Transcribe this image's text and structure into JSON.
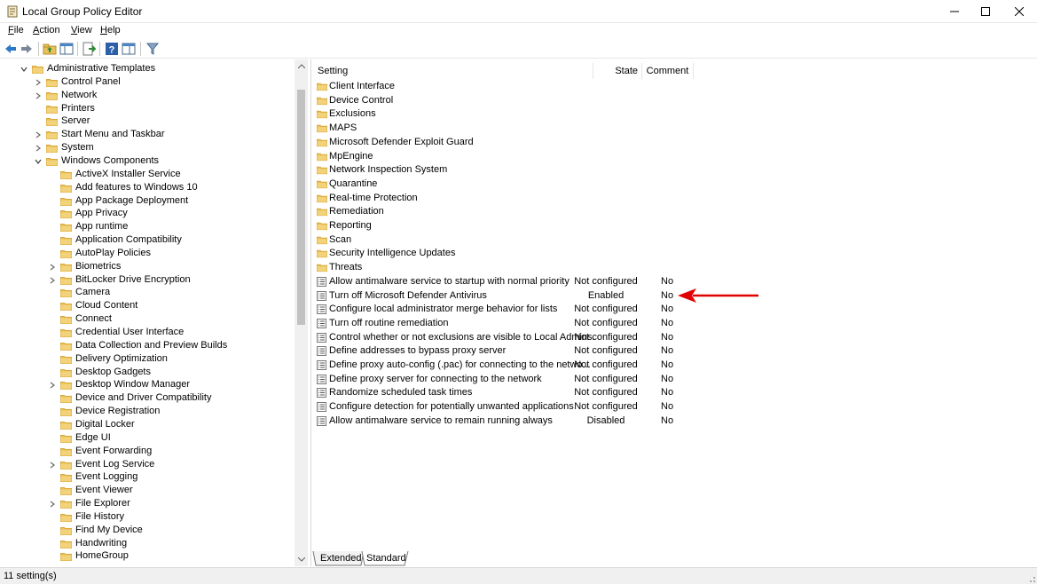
{
  "window": {
    "title": "Local Group Policy Editor",
    "app_icon": "policy-editor-icon",
    "controls": [
      "minimize-icon",
      "maximize-icon",
      "close-icon"
    ]
  },
  "menu": {
    "file": {
      "key": "F",
      "rest": "ile"
    },
    "action": {
      "key": "A",
      "rest": "ction"
    },
    "view": {
      "key": "V",
      "rest": "iew"
    },
    "help": {
      "key": "H",
      "rest": "elp"
    }
  },
  "toolbar": {
    "icons": [
      "back-icon",
      "forward-icon",
      "up-folder-icon",
      "show-hide-tree-icon",
      "export-list-icon",
      "help-icon",
      "extended-view-icon",
      "filter-icon"
    ]
  },
  "tree": {
    "items": [
      {
        "label": "Administrative Templates",
        "level": 1,
        "expander": "expanded"
      },
      {
        "label": "Control Panel",
        "level": 2,
        "expander": "collapsed"
      },
      {
        "label": "Network",
        "level": 2,
        "expander": "collapsed"
      },
      {
        "label": "Printers",
        "level": 2,
        "expander": "none"
      },
      {
        "label": "Server",
        "level": 2,
        "expander": "none"
      },
      {
        "label": "Start Menu and Taskbar",
        "level": 2,
        "expander": "collapsed"
      },
      {
        "label": "System",
        "level": 2,
        "expander": "collapsed"
      },
      {
        "label": "Windows Components",
        "level": 2,
        "expander": "expanded"
      },
      {
        "label": "ActiveX Installer Service",
        "level": 3,
        "expander": "none"
      },
      {
        "label": "Add features to Windows 10",
        "level": 3,
        "expander": "none"
      },
      {
        "label": "App Package Deployment",
        "level": 3,
        "expander": "none"
      },
      {
        "label": "App Privacy",
        "level": 3,
        "expander": "none"
      },
      {
        "label": "App runtime",
        "level": 3,
        "expander": "none"
      },
      {
        "label": "Application Compatibility",
        "level": 3,
        "expander": "none"
      },
      {
        "label": "AutoPlay Policies",
        "level": 3,
        "expander": "none"
      },
      {
        "label": "Biometrics",
        "level": 3,
        "expander": "collapsed"
      },
      {
        "label": "BitLocker Drive Encryption",
        "level": 3,
        "expander": "collapsed"
      },
      {
        "label": "Camera",
        "level": 3,
        "expander": "none"
      },
      {
        "label": "Cloud Content",
        "level": 3,
        "expander": "none"
      },
      {
        "label": "Connect",
        "level": 3,
        "expander": "none"
      },
      {
        "label": "Credential User Interface",
        "level": 3,
        "expander": "none"
      },
      {
        "label": "Data Collection and Preview Builds",
        "level": 3,
        "expander": "none"
      },
      {
        "label": "Delivery Optimization",
        "level": 3,
        "expander": "none"
      },
      {
        "label": "Desktop Gadgets",
        "level": 3,
        "expander": "none"
      },
      {
        "label": "Desktop Window Manager",
        "level": 3,
        "expander": "collapsed"
      },
      {
        "label": "Device and Driver Compatibility",
        "level": 3,
        "expander": "none"
      },
      {
        "label": "Device Registration",
        "level": 3,
        "expander": "none"
      },
      {
        "label": "Digital Locker",
        "level": 3,
        "expander": "none"
      },
      {
        "label": "Edge UI",
        "level": 3,
        "expander": "none"
      },
      {
        "label": "Event Forwarding",
        "level": 3,
        "expander": "none"
      },
      {
        "label": "Event Log Service",
        "level": 3,
        "expander": "collapsed"
      },
      {
        "label": "Event Logging",
        "level": 3,
        "expander": "none"
      },
      {
        "label": "Event Viewer",
        "level": 3,
        "expander": "none"
      },
      {
        "label": "File Explorer",
        "level": 3,
        "expander": "collapsed"
      },
      {
        "label": "File History",
        "level": 3,
        "expander": "none"
      },
      {
        "label": "Find My Device",
        "level": 3,
        "expander": "none"
      },
      {
        "label": "Handwriting",
        "level": 3,
        "expander": "none"
      },
      {
        "label": "HomeGroup",
        "level": 3,
        "expander": "none"
      }
    ]
  },
  "list": {
    "columns": {
      "setting": "Setting",
      "state": "State",
      "comment": "Comment"
    },
    "folders": [
      "Client Interface",
      "Device Control",
      "Exclusions",
      "MAPS",
      "Microsoft Defender Exploit Guard",
      "MpEngine",
      "Network Inspection System",
      "Quarantine",
      "Real-time Protection",
      "Remediation",
      "Reporting",
      "Scan",
      "Security Intelligence Updates",
      "Threats"
    ],
    "settings": [
      {
        "name": "Allow antimalware service to startup with normal priority",
        "state": "Not configured",
        "comment": "No"
      },
      {
        "name": "Turn off Microsoft Defender Antivirus",
        "state": "Enabled",
        "comment": "No"
      },
      {
        "name": "Configure local administrator merge behavior for lists",
        "state": "Not configured",
        "comment": "No"
      },
      {
        "name": "Turn off routine remediation",
        "state": "Not configured",
        "comment": "No"
      },
      {
        "name": "Control whether or not exclusions are visible to Local Admins.",
        "state": "Not configured",
        "comment": "No"
      },
      {
        "name": "Define addresses to bypass proxy server",
        "state": "Not configured",
        "comment": "No"
      },
      {
        "name": "Define proxy auto-config (.pac) for connecting to the netwo...",
        "state": "Not configured",
        "comment": "No"
      },
      {
        "name": "Define proxy server for connecting to the network",
        "state": "Not configured",
        "comment": "No"
      },
      {
        "name": "Randomize scheduled task times",
        "state": "Not configured",
        "comment": "No"
      },
      {
        "name": "Configure detection for potentially unwanted applications",
        "state": "Not configured",
        "comment": "No"
      },
      {
        "name": "Allow antimalware service to remain running always",
        "state": "Disabled",
        "comment": "No"
      }
    ]
  },
  "tabs": {
    "extended": "Extended",
    "standard": "Standard"
  },
  "status": {
    "text": "11 setting(s)"
  },
  "colors": {
    "folder": "#e8c15a",
    "folder_dark": "#d9a736",
    "annotation_arrow": "#e00000",
    "statusbar": "#f0f0f0"
  }
}
